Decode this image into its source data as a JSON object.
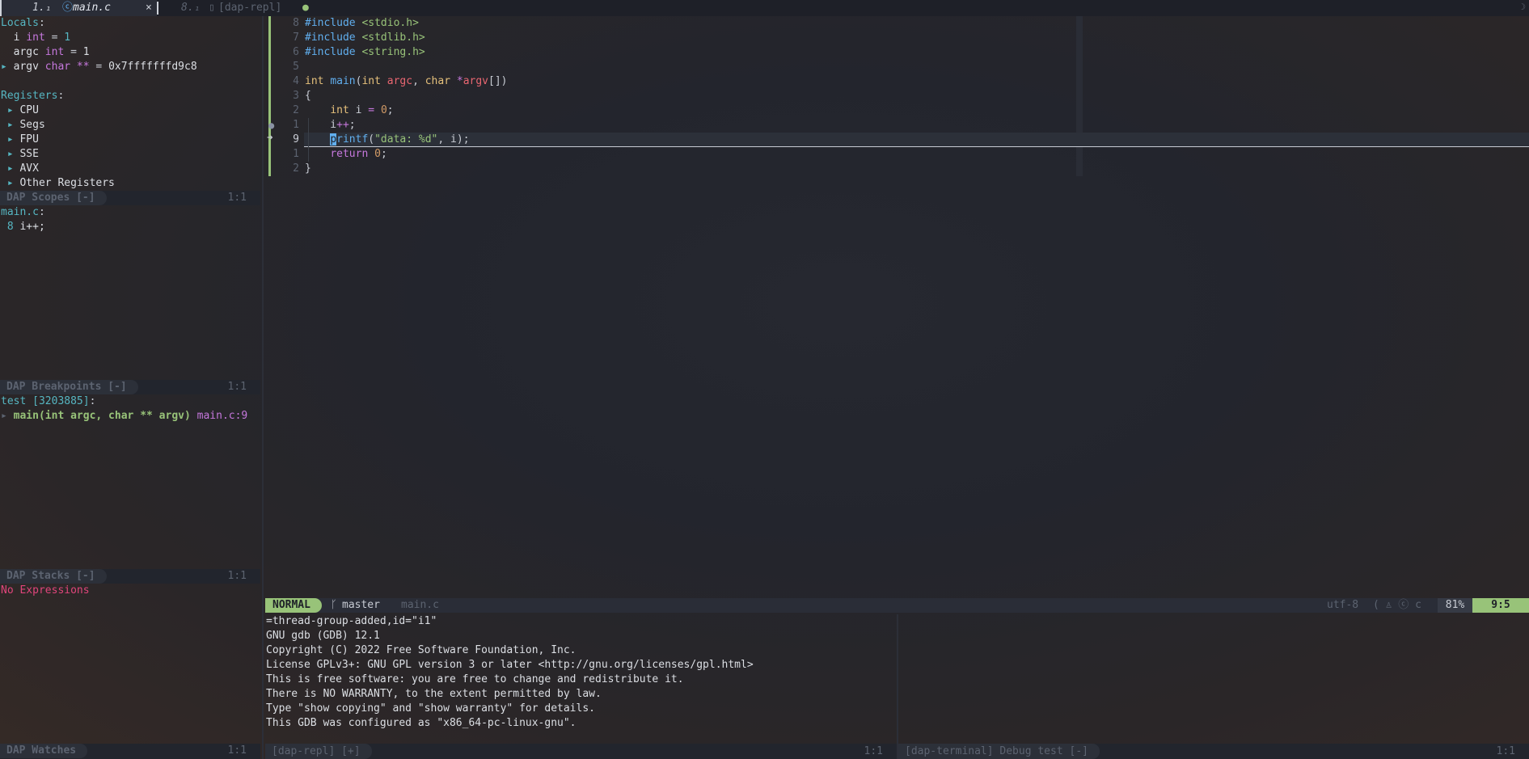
{
  "tabline": {
    "tab1": {
      "number": "1.₁",
      "file_icon": "c-file-icon",
      "file": "main.c",
      "close": "×"
    },
    "tab2": {
      "number": "8.₁",
      "file": "[dap-repl]",
      "modified_dot": "●"
    },
    "right_glyph": "☽"
  },
  "scopes": {
    "locals_header": "Locals",
    "locals": [
      {
        "expander": " ",
        "name": "i",
        "type": "int",
        "value": "1"
      },
      {
        "expander": " ",
        "name": "argc",
        "type": "int",
        "value": "1"
      },
      {
        "expander": "▸",
        "name": "argv",
        "type": "char **",
        "value": "0x7fffffffd9c8"
      }
    ],
    "registers_header": "Registers",
    "registers": [
      "CPU",
      "Segs",
      "FPU",
      "SSE",
      "AVX",
      "Other Registers"
    ],
    "status": {
      "label": "DAP Scopes [-]",
      "position": "1:1"
    }
  },
  "breakpoints": {
    "file": "main.c",
    "items": [
      {
        "line": "8",
        "code": "i++;"
      }
    ],
    "status": {
      "label": "DAP Breakpoints [-]",
      "position": "1:1"
    }
  },
  "stacks": {
    "thread": "test [3203885]",
    "frames": [
      {
        "func": "main(int argc, char ** argv)",
        "loc": "main.c:9"
      }
    ],
    "status": {
      "label": "DAP Stacks [-]",
      "position": "1:1"
    }
  },
  "watches": {
    "empty_text": "No Expressions",
    "status": {
      "label": "DAP Watches",
      "position": "1:1"
    }
  },
  "editor": {
    "lines": [
      {
        "num": "8",
        "tokens": [
          [
            "#include",
            "blue"
          ],
          [
            " ",
            ""
          ],
          [
            "<stdio.h>",
            "green"
          ]
        ]
      },
      {
        "num": "7",
        "tokens": [
          [
            "#include",
            "blue"
          ],
          [
            " ",
            ""
          ],
          [
            "<stdlib.h>",
            "green"
          ]
        ]
      },
      {
        "num": "6",
        "tokens": [
          [
            "#include",
            "blue"
          ],
          [
            " ",
            ""
          ],
          [
            "<string.h>",
            "green"
          ]
        ]
      },
      {
        "num": "5",
        "tokens": []
      },
      {
        "num": "4",
        "tokens": [
          [
            "int",
            "yellow"
          ],
          [
            " ",
            ""
          ],
          [
            "main",
            "blue"
          ],
          [
            "(",
            ""
          ],
          [
            "int",
            "yellow"
          ],
          [
            " ",
            ""
          ],
          [
            "argc",
            "red"
          ],
          [
            ", ",
            ""
          ],
          [
            "char",
            "yellow"
          ],
          [
            " ",
            ""
          ],
          [
            "*",
            "purple"
          ],
          [
            "argv",
            "red"
          ],
          [
            "[])",
            ""
          ]
        ]
      },
      {
        "num": "3",
        "tokens": [
          [
            "{",
            ""
          ]
        ]
      },
      {
        "num": "2",
        "tokens": [
          [
            "    ",
            ""
          ],
          [
            "int",
            "yellow"
          ],
          [
            " i ",
            ""
          ],
          [
            "=",
            "purple"
          ],
          [
            " ",
            ""
          ],
          [
            "0",
            "orange"
          ],
          [
            ";",
            ""
          ]
        ]
      },
      {
        "num": "1",
        "tokens": [
          [
            "    i",
            ""
          ],
          [
            "++",
            "purple"
          ],
          [
            ";",
            ""
          ]
        ]
      },
      {
        "num": "9",
        "tokens": [
          [
            "    ",
            ""
          ],
          [
            "p",
            "cursor"
          ],
          [
            "rintf",
            "blue"
          ],
          [
            "(",
            ""
          ],
          [
            "\"data: %d\"",
            "green"
          ],
          [
            ", i);",
            ""
          ]
        ]
      },
      {
        "num": "1",
        "tokens": [
          [
            "    ",
            ""
          ],
          [
            "return",
            "purple"
          ],
          [
            " ",
            ""
          ],
          [
            "0",
            "orange"
          ],
          [
            ";",
            ""
          ]
        ]
      },
      {
        "num": "2",
        "tokens": [
          [
            "}",
            ""
          ]
        ]
      }
    ],
    "current_line_index": 8
  },
  "statusline": {
    "mode": "NORMAL",
    "branch_icon": "ᚴ",
    "branch": "master",
    "file": "main.c",
    "encoding": "utf-8",
    "os_icons": "( ♙ ⓒ c",
    "percent": "81%",
    "position": "9:5"
  },
  "repl": {
    "lines": [
      "=thread-group-added,id=\"i1\"",
      "GNU gdb (GDB) 12.1",
      "Copyright (C) 2022 Free Software Foundation, Inc.",
      "License GPLv3+: GNU GPL version 3 or later <http://gnu.org/licenses/gpl.html>",
      "This is free software: you are free to change and redistribute it.",
      "There is NO WARRANTY, to the extent permitted by law.",
      "Type \"show copying\" and \"show warranty\" for details.",
      "This GDB was configured as \"x86_64-pc-linux-gnu\"."
    ],
    "status": {
      "label": "[dap-repl] [+]",
      "position": "1:1"
    }
  },
  "terminal": {
    "status": {
      "label": "[dap-terminal] Debug test [-]",
      "position": "1:1"
    }
  },
  "colors": {
    "accent_green": "#98c379",
    "keyword_purple": "#c678dd",
    "function_blue": "#61afef",
    "type_yellow": "#e5c07b",
    "param_red": "#e86671",
    "number_orange": "#d19a66",
    "header_cyan": "#56b6c2",
    "error_pink": "#e0457b"
  }
}
